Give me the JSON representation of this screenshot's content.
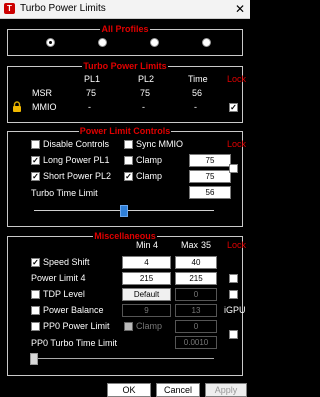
{
  "window": {
    "title": "Turbo Power Limits",
    "app_icon_letter": "T",
    "close_glyph": "✕"
  },
  "all_profiles": {
    "title": "All Profiles",
    "selected_index": 0
  },
  "turbo_power_limits": {
    "title": "Turbo Power Limits",
    "lock_label": "Lock",
    "headers": [
      "PL1",
      "PL2",
      "Time"
    ],
    "rows": [
      {
        "label": "MSR",
        "values": [
          "75",
          "75",
          "56"
        ]
      },
      {
        "label": "MMIO",
        "values": [
          "-",
          "-",
          "-"
        ]
      }
    ],
    "mmio_lock_checked": true
  },
  "power_limit_controls": {
    "title": "Power Limit Controls",
    "lock_label": "Lock",
    "disable_controls": {
      "label": "Disable Controls",
      "checked": false
    },
    "sync_mmio": {
      "label": "Sync MMIO",
      "checked": false
    },
    "long_power": {
      "label": "Long Power PL1",
      "checked": true
    },
    "short_power": {
      "label": "Short Power PL2",
      "checked": true
    },
    "clamp1": {
      "label": "Clamp",
      "checked": false,
      "value": "75"
    },
    "clamp2": {
      "label": "Clamp",
      "checked": true,
      "value": "75"
    },
    "lock_checked": false,
    "turbo_time_limit": {
      "label": "Turbo Time Limit",
      "value": "56"
    },
    "slider_level": 0.5
  },
  "miscellaneous": {
    "title": "Miscellaneous",
    "min_label": "Min",
    "min_value": "4",
    "max_label": "Max",
    "max_value": "35",
    "lock_label": "Lock",
    "speed_shift": {
      "label": "Speed Shift",
      "checked": true,
      "min": "4",
      "max": "40"
    },
    "power_limit_4": {
      "label": "Power Limit 4",
      "v1": "215",
      "v2": "215",
      "lock_checked": false
    },
    "tdp_level": {
      "label": "TDP Level",
      "checked": false,
      "v1": "Default",
      "v2": "0",
      "lock_checked": false
    },
    "power_balance": {
      "label": "Power Balance",
      "checked": false,
      "v1": "9",
      "v2": "13",
      "side_label": "iGPU"
    },
    "pp0_power_limit": {
      "label": "PP0 Power Limit",
      "checked": false,
      "clamp_label": "Clamp",
      "value": "0",
      "lock_checked": false
    },
    "pp0_turbo_time_limit": {
      "label": "PP0 Turbo Time Limit",
      "value": "0.0010"
    },
    "slider_level": 0.0
  },
  "buttons": {
    "ok": "OK",
    "cancel": "Cancel",
    "apply": "Apply"
  },
  "colors": {
    "accent": "#e00000",
    "background": "#000000",
    "slider_thumb": "#2f7fd8"
  }
}
